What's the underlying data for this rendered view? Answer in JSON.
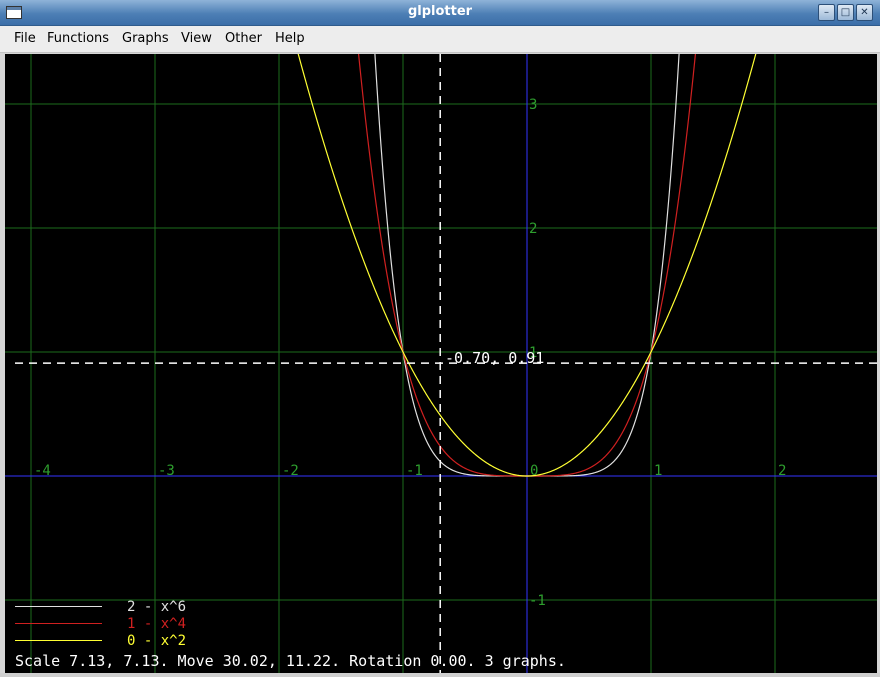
{
  "window": {
    "title": "glplotter"
  },
  "menu": {
    "items": [
      "File",
      "Functions",
      "Graphs",
      "View",
      "Other",
      "Help"
    ]
  },
  "plot": {
    "x_ticks": [
      "-4",
      "-3",
      "-2",
      "-1",
      "0",
      "1",
      "2"
    ],
    "y_ticks": [
      "3",
      "2",
      "1",
      "-1"
    ],
    "cursor_coords": "-0.70, 0.91",
    "colors": {
      "grid": "#1d6b1d",
      "axis": "#3333ff",
      "tick_label": "#2e9e2e",
      "cursor": "#ffffff"
    }
  },
  "legend": [
    {
      "text": "2 - x^6",
      "color": "#e0e0e0"
    },
    {
      "text": "1 - x^4",
      "color": "#d02020"
    },
    {
      "text": "0 - x^2",
      "color": "#ffff33"
    }
  ],
  "status": "Scale 7.13, 7.13. Move 30.02, 11.22. Rotation 0.00. 3 graphs.",
  "chart_data": {
    "type": "line",
    "xlim": [
      -4.25,
      2.8
    ],
    "ylim": [
      -1.5,
      3.4
    ],
    "grid": true,
    "series": [
      {
        "name": "x^6",
        "exponent": 6,
        "color": "#e0e0e0"
      },
      {
        "name": "x^4",
        "exponent": 4,
        "color": "#d02020"
      },
      {
        "name": "x^2",
        "exponent": 2,
        "color": "#ffff33"
      }
    ],
    "cursor": {
      "x": -0.7,
      "y": 0.91
    }
  }
}
